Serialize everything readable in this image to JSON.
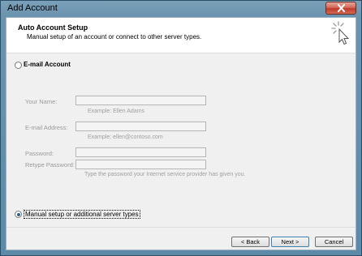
{
  "window": {
    "title": "Add Account"
  },
  "header": {
    "title": "Auto Account Setup",
    "subtitle": "Manual setup of an account or connect to other server types."
  },
  "options": {
    "email_account": {
      "label": "E-mail Account",
      "selected": false
    },
    "manual_setup": {
      "label": "Manual setup or additional server types",
      "selected": true
    }
  },
  "form": {
    "your_name": {
      "label": "Your Name:",
      "value": "",
      "hint": "Example: Ellen Adams"
    },
    "email_address": {
      "label": "E-mail Address:",
      "value": "",
      "hint": "Example: ellen@contoso.com"
    },
    "password": {
      "label": "Password:",
      "value": ""
    },
    "retype_password": {
      "label": "Retype Password:",
      "value": "",
      "hint": "Type the password your Internet service provider has given you."
    }
  },
  "buttons": {
    "back": "< Back",
    "next": "Next >",
    "cancel": "Cancel"
  },
  "icons": {
    "close": "close-icon",
    "wizard": "wizard-cursor-icon"
  }
}
